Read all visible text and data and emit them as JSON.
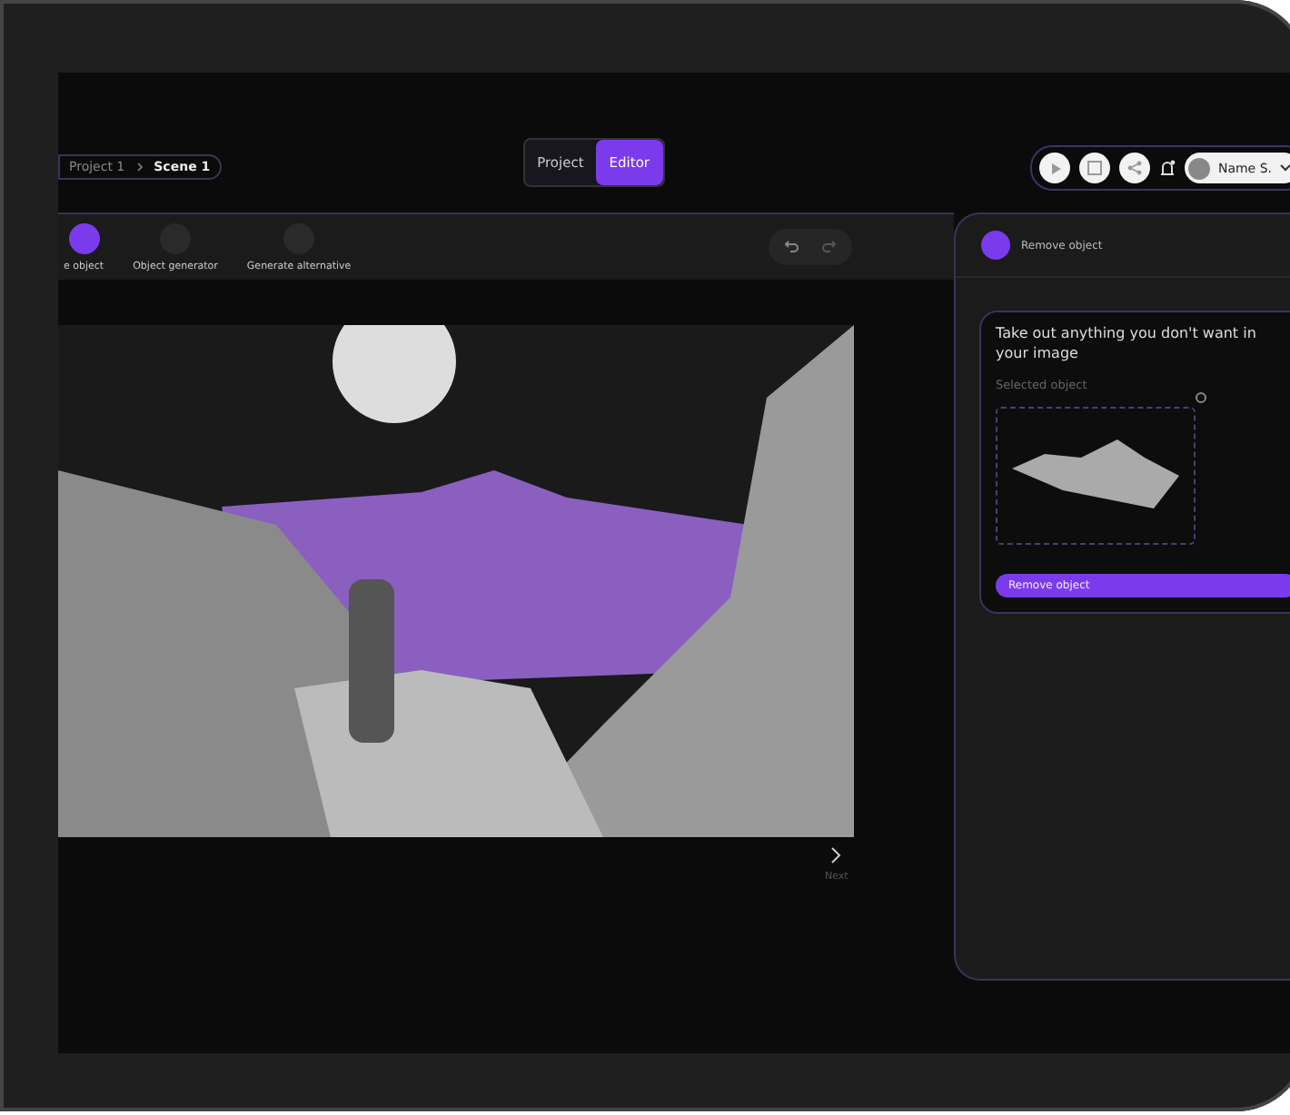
{
  "breadcrumb": [
    "Project 1",
    "Scene 1"
  ],
  "mode_tabs": [
    {
      "label": "Project",
      "selected": false
    },
    {
      "label": "Editor",
      "selected": true
    }
  ],
  "user": {
    "name": "Name S."
  },
  "tools": [
    {
      "label": "e object",
      "selected": true
    },
    {
      "label": "Object generator",
      "selected": false
    },
    {
      "label": "Generate alternative",
      "selected": false
    }
  ],
  "next": {
    "label": "Next"
  },
  "panel": {
    "title": "Remove object",
    "prompt": "Take out anything you don't want in your image",
    "selected_label": "Selected object",
    "button": "Remove object"
  }
}
